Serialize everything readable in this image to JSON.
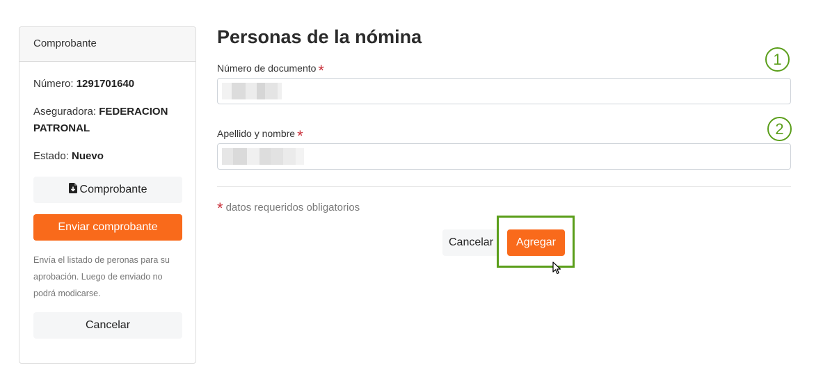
{
  "sidebar": {
    "header": "Comprobante",
    "numero_label": "Número:",
    "numero_value": "1291701640",
    "aseguradora_label": "Aseguradora:",
    "aseguradora_value": "FEDERACION PATRONAL",
    "estado_label": "Estado:",
    "estado_value": "Nuevo",
    "comprobante_button": "Comprobante",
    "enviar_button": "Enviar comprobante",
    "note": "Envía el listado de peronas para su aprobación. Luego de enviado no podrá modicarse.",
    "cancel_button": "Cancelar"
  },
  "form": {
    "title": "Personas de la nómina",
    "documento_label": "Número de documento",
    "nombre_label": "Apellido y nombre",
    "required_mark": "*",
    "required_note": "datos requeridos obligatorios",
    "cancel_button": "Cancelar",
    "add_button": "Agregar"
  },
  "annotations": {
    "step1": "1",
    "step2": "2"
  },
  "icons": {
    "comprobante": "file-download-icon",
    "cursor": "mouse-pointer-icon"
  },
  "colors": {
    "accent": "#f96a1b",
    "required": "#c9303a",
    "annotation": "#5a9e1a"
  }
}
